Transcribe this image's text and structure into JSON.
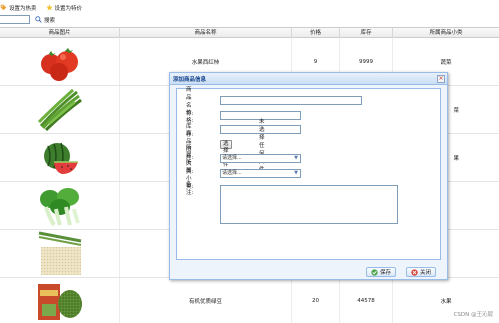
{
  "toolbar": {
    "set_hot_label": "设置为热卖",
    "set_special_label": "设置为特价",
    "search_label": "搜索",
    "search_value": ""
  },
  "grid": {
    "columns": [
      "商品图片",
      "商品名称",
      "价格",
      "库存",
      "所属商品小类"
    ],
    "rows": [
      {
        "image": "tomato",
        "name": "水果西红柿",
        "price": "9",
        "stock": "9999",
        "subcategory": "蔬菜"
      },
      {
        "image": "green-beans",
        "name": "",
        "price": "",
        "stock": "",
        "subcategory": "菜"
      },
      {
        "image": "watermelon",
        "name": "",
        "price": "",
        "stock": "",
        "subcategory": "果"
      },
      {
        "image": "bok-choy",
        "name": "",
        "price": "",
        "stock": "",
        "subcategory": ""
      },
      {
        "image": "rice",
        "name": "",
        "price": "",
        "stock": "",
        "subcategory": ""
      },
      {
        "image": "mung-beans",
        "name": "有机优质绿豆",
        "price": "20",
        "stock": "44578",
        "subcategory": "水果"
      }
    ]
  },
  "dialog": {
    "title": "添加商品信息",
    "fields": {
      "name_label": "商品名称:",
      "name_value": "",
      "price_label": "价格:",
      "price_value": "",
      "stock_label": "库存:",
      "stock_value": "",
      "image_label": "商品图片:",
      "file_button": "选择文件",
      "file_status": "未选择任何文件",
      "category_label": "所属大类:",
      "category_value": "请选择...",
      "subcategory_label": "所属小类:",
      "subcategory_value": "请选择...",
      "remark_label": "备注:",
      "remark_value": ""
    },
    "save_label": "保存",
    "close_label": "关闭"
  },
  "watermark": "CSDN @王沁屁",
  "colors": {
    "dialog_border": "#99bbe8",
    "title_text": "#15428b",
    "input_border": "#7f9db9"
  }
}
